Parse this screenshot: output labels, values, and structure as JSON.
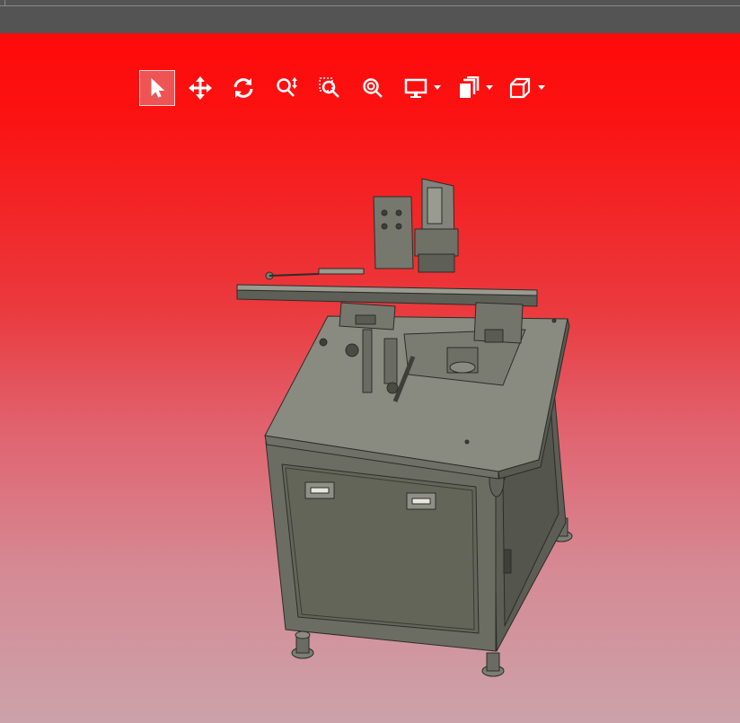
{
  "app": {
    "viewport_background": [
      "#ff0a0a",
      "#cca2aa"
    ]
  },
  "toolbar": {
    "buttons": [
      {
        "id": "select",
        "icon": "pointer-icon",
        "selected": true
      },
      {
        "id": "pan",
        "icon": "move-arrows-icon",
        "selected": false
      },
      {
        "id": "rotate",
        "icon": "rotate-icon",
        "selected": false
      },
      {
        "id": "zoom",
        "icon": "zoom-updown-icon",
        "selected": false
      },
      {
        "id": "zoom-window",
        "icon": "zoom-window-icon",
        "selected": false
      },
      {
        "id": "zoom-fit",
        "icon": "zoom-fit-icon",
        "selected": false
      },
      {
        "id": "display",
        "icon": "monitor-icon",
        "has_dropdown": true
      },
      {
        "id": "section",
        "icon": "section-view-icon",
        "has_dropdown": true
      },
      {
        "id": "view-orientation",
        "icon": "cube-icon",
        "has_dropdown": true
      }
    ]
  },
  "model": {
    "description_icon": "machine-3d-model",
    "colors": {
      "top": "#8a8b80",
      "front": "#6c6d62",
      "side": "#5a5b52",
      "edge": "#2c2d28"
    }
  }
}
